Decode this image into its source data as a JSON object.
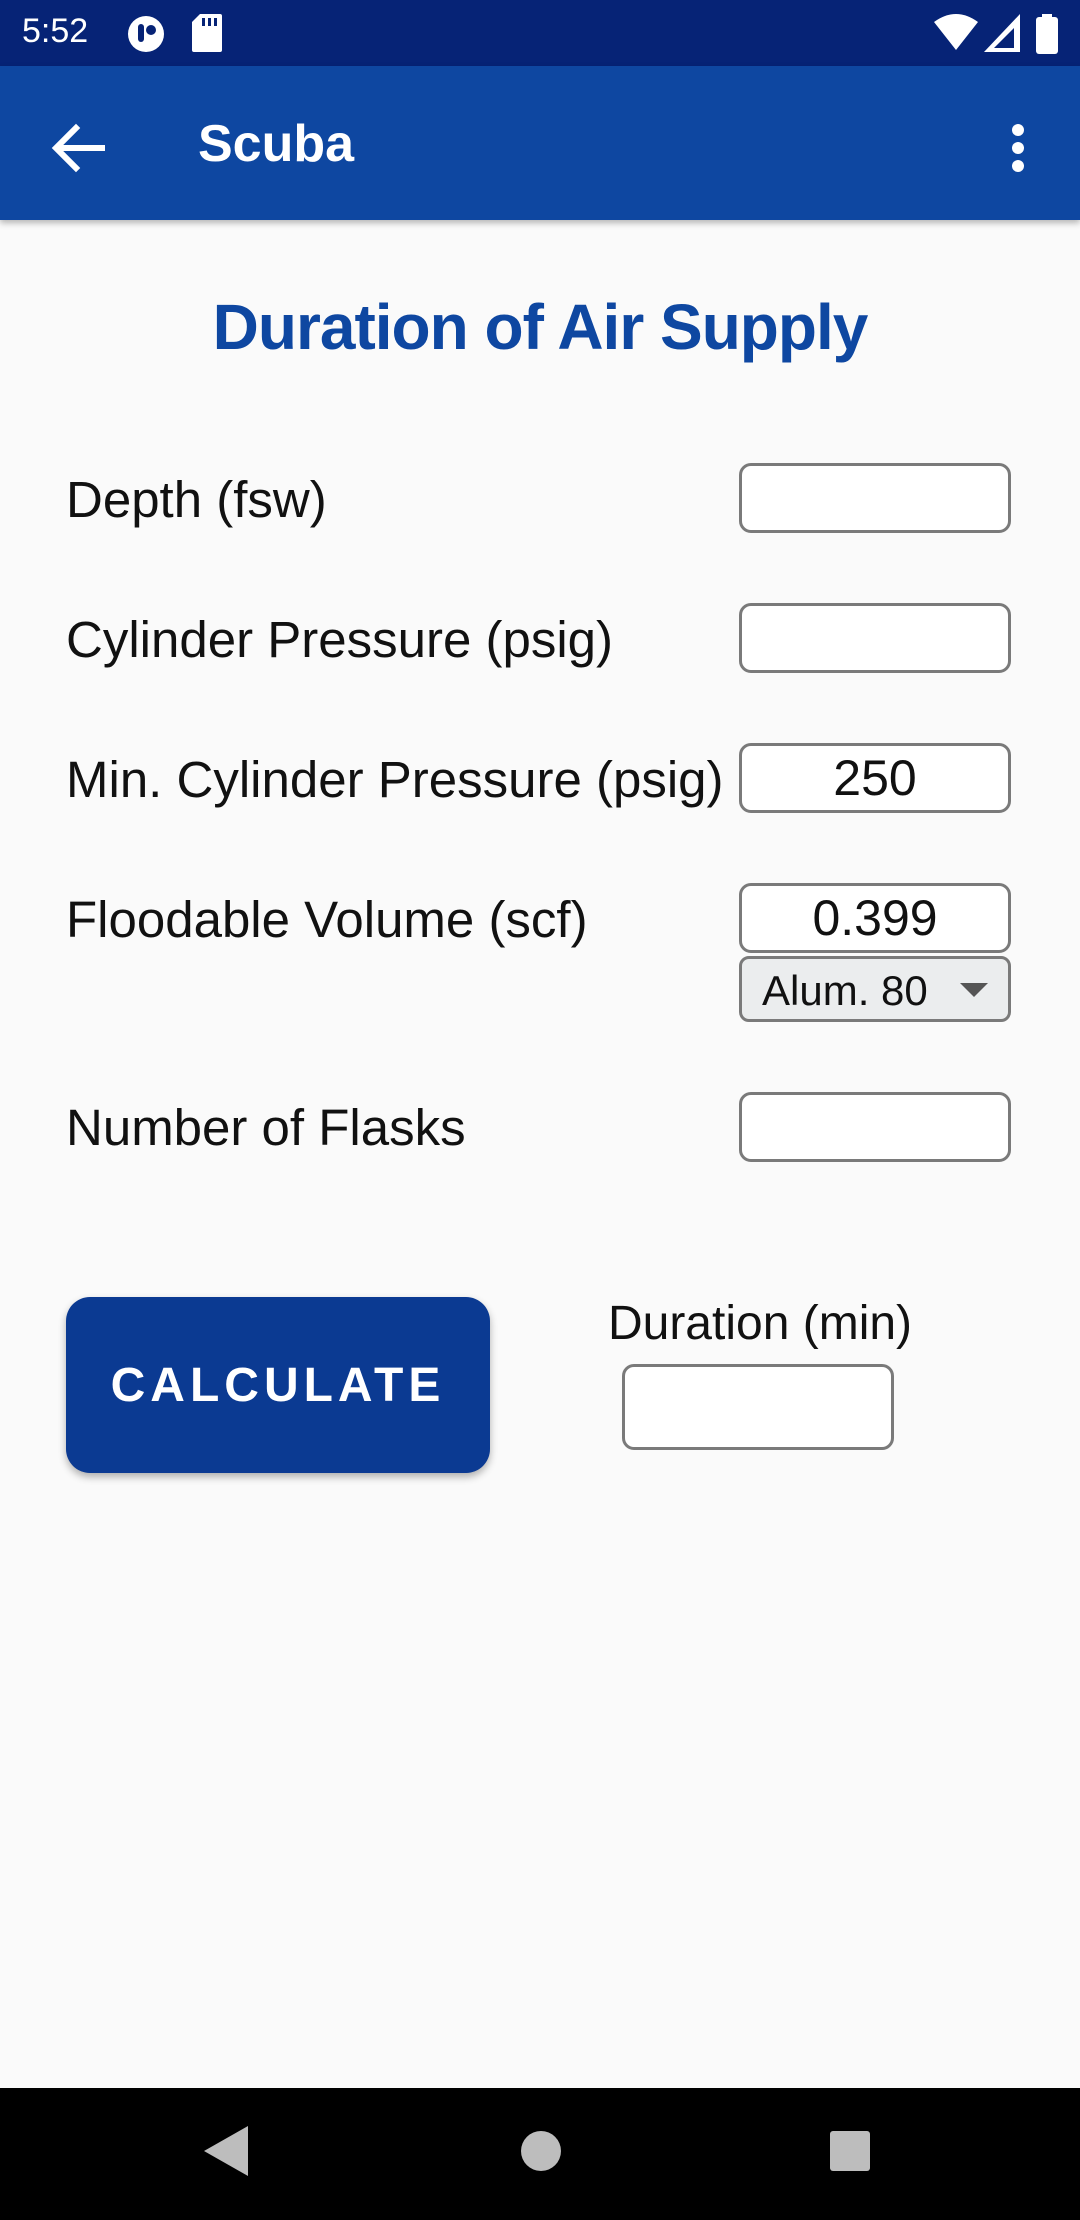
{
  "status_bar": {
    "time": "5:52",
    "icons": [
      "app-notification-icon",
      "sd-card-icon",
      "wifi-icon",
      "signal-icon",
      "battery-icon"
    ]
  },
  "app_bar": {
    "title": "Scuba",
    "back_icon": "arrow-back-icon",
    "menu_icon": "more-vert-icon"
  },
  "form": {
    "title": "Duration of Air Supply",
    "fields": [
      {
        "label": "Depth (fsw)",
        "value": ""
      },
      {
        "label": "Cylinder Pressure (psig)",
        "value": ""
      },
      {
        "label": "Min. Cylinder Pressure (psig)",
        "value": "250"
      },
      {
        "label": "Floodable Volume (scf)",
        "value": "0.399"
      },
      {
        "label": "Number of Flasks",
        "value": ""
      }
    ],
    "cylinder_select": {
      "selected": "Alum. 80"
    },
    "calculate_label": "CALCULATE",
    "duration": {
      "label": "Duration (min)",
      "value": ""
    }
  },
  "colors": {
    "status_bar": "#062376",
    "app_bar": "#0e47a1",
    "title": "#0e47a1",
    "button": "#0b3a92"
  }
}
